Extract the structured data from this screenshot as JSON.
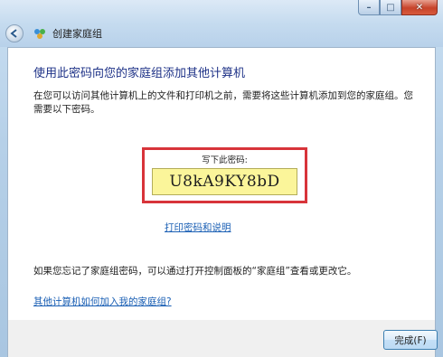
{
  "window": {
    "title": "创建家庭组",
    "caption": {
      "minimize": "–",
      "maximize": "□",
      "close": "✕"
    }
  },
  "main": {
    "heading": "使用此密码向您的家庭组添加其他计算机",
    "description": "在您可以访问其他计算机上的文件和打印机之前，需要将这些计算机添加到您的家庭组。您需要以下密码。",
    "password_label": "写下此密码:",
    "password": "U8kA9KY8bD",
    "print_link": "打印密码和说明",
    "forgot_text": "如果您忘记了家庭组密码，可以通过打开控制面板的“家庭组”查看或更改它。",
    "join_link": "其他计算机如何加入我的家庭组?"
  },
  "footer": {
    "finish_label": "完成(F)"
  },
  "colors": {
    "heading": "#1e3287",
    "link": "#1a5fb4",
    "highlight_border": "#d8343a",
    "password_bg": "#fbf59a"
  }
}
